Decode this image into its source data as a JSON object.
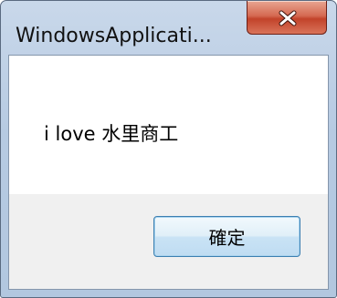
{
  "window": {
    "title": "WindowsApplicati...",
    "close_icon": "close-icon"
  },
  "dialog": {
    "message": "i love 水里商工",
    "ok_label": "確定"
  },
  "colors": {
    "close_button": "#c2432a",
    "frame": "#b6cae2",
    "ok_border": "#3c7fb1"
  }
}
